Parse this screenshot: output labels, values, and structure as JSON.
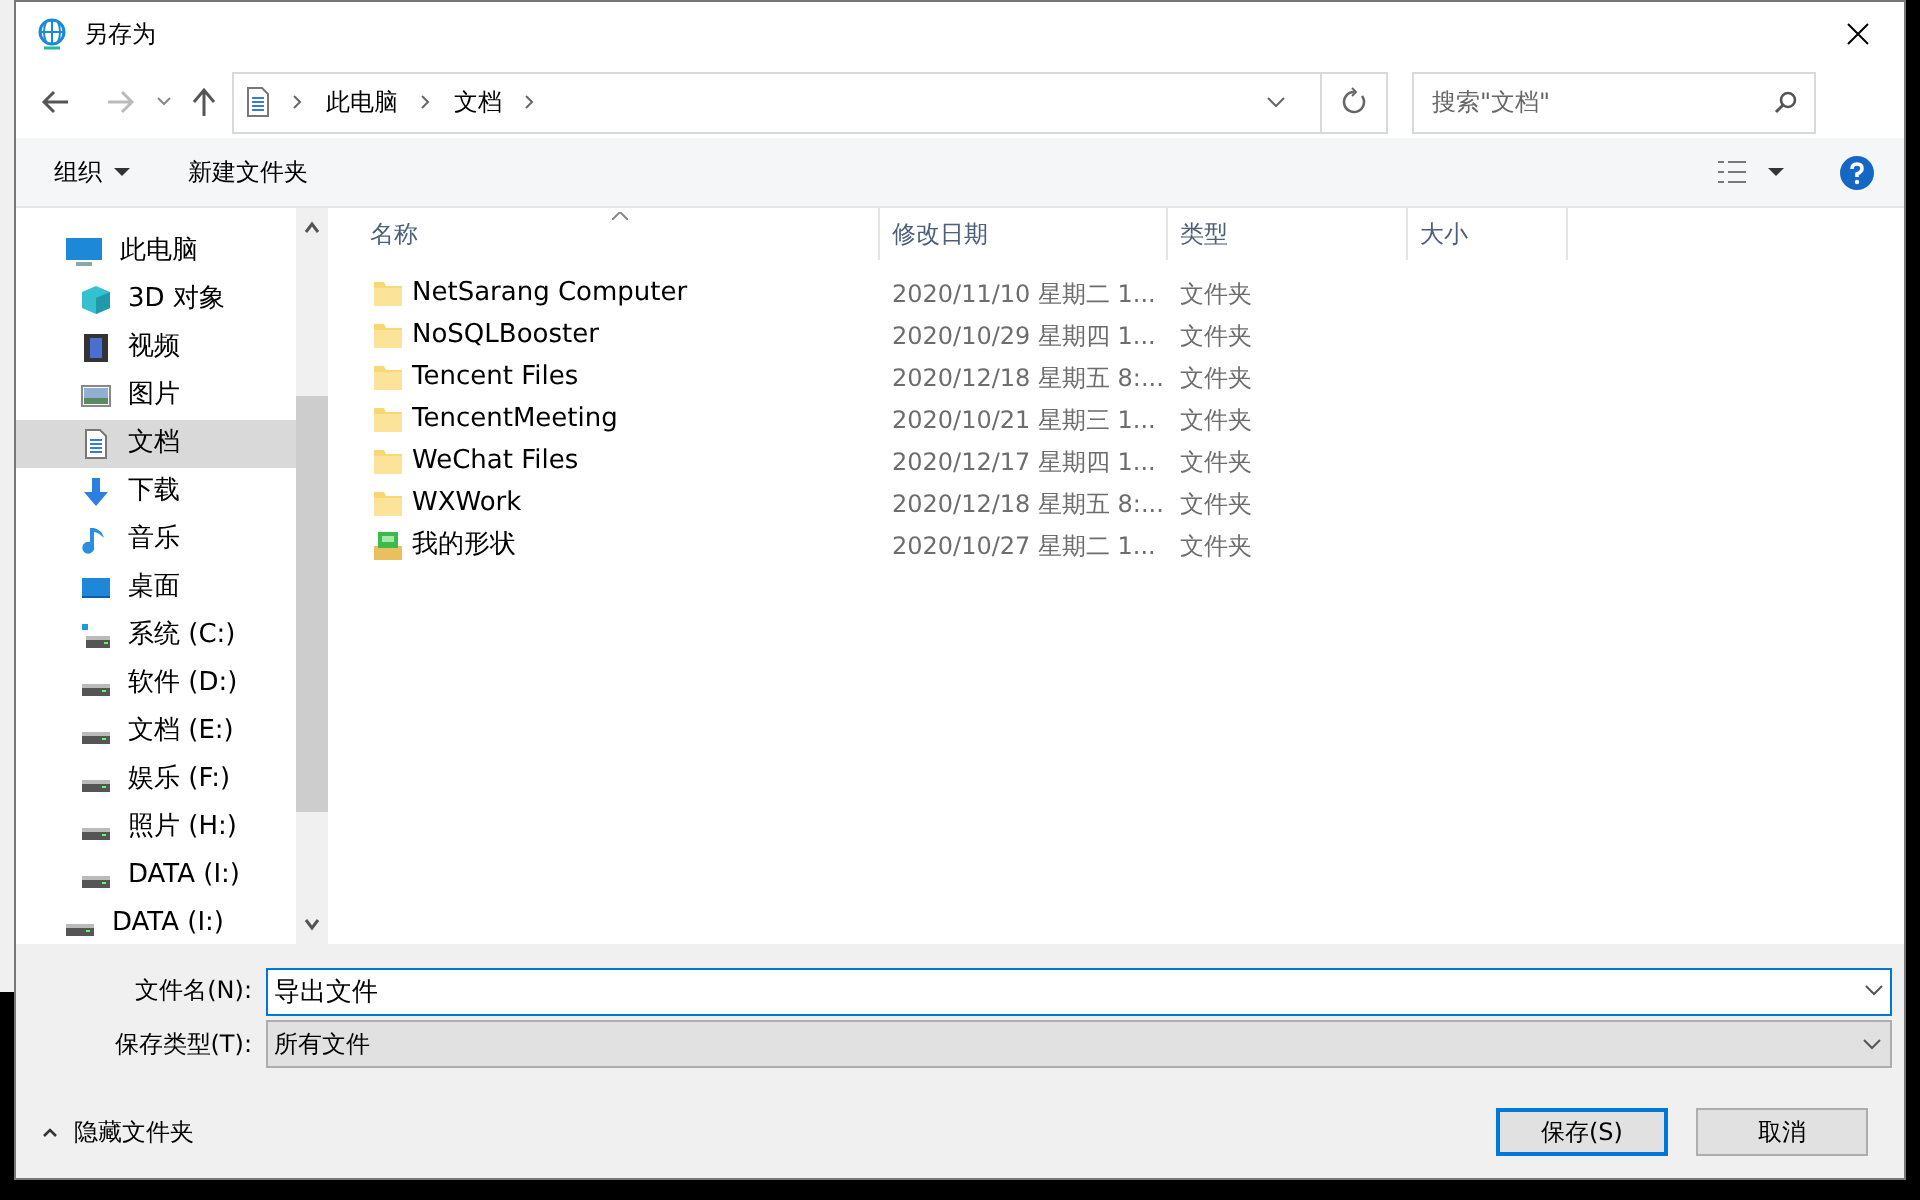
{
  "window": {
    "title": "另存为"
  },
  "address": {
    "path": [
      "此电脑",
      "文档"
    ]
  },
  "search": {
    "placeholder": "搜索\"文档\""
  },
  "toolbar": {
    "organize": "组织",
    "new_folder": "新建文件夹"
  },
  "sidebar": {
    "items": [
      {
        "label": "此电脑",
        "kind": "pc",
        "selected": false,
        "children": [
          {
            "label": "3D 对象",
            "kind": "cube",
            "selected": false
          },
          {
            "label": "视频",
            "kind": "video",
            "selected": false
          },
          {
            "label": "图片",
            "kind": "picture",
            "selected": false
          },
          {
            "label": "文档",
            "kind": "document",
            "selected": true
          },
          {
            "label": "下载",
            "kind": "download",
            "selected": false
          },
          {
            "label": "音乐",
            "kind": "music",
            "selected": false
          },
          {
            "label": "桌面",
            "kind": "desktop",
            "selected": false
          },
          {
            "label": "系统 (C:)",
            "kind": "system-drive",
            "selected": false
          },
          {
            "label": "软件 (D:)",
            "kind": "drive",
            "selected": false
          },
          {
            "label": "文档 (E:)",
            "kind": "drive",
            "selected": false
          },
          {
            "label": "娱乐 (F:)",
            "kind": "drive",
            "selected": false
          },
          {
            "label": "照片 (H:)",
            "kind": "drive",
            "selected": false
          },
          {
            "label": "DATA (I:)",
            "kind": "drive",
            "selected": false
          }
        ]
      },
      {
        "label": "DATA (I:)",
        "kind": "drive",
        "selected": false
      }
    ]
  },
  "table": {
    "columns": [
      "名称",
      "修改日期",
      "类型",
      "大小"
    ],
    "rows": [
      {
        "name": "NetSarang Computer",
        "date": "2020/11/10 星期二 1...",
        "type": "文件夹",
        "kind": "folder"
      },
      {
        "name": "NoSQLBooster",
        "date": "2020/10/29 星期四 1...",
        "type": "文件夹",
        "kind": "folder"
      },
      {
        "name": "Tencent Files",
        "date": "2020/12/18 星期五 8:...",
        "type": "文件夹",
        "kind": "folder"
      },
      {
        "name": "TencentMeeting",
        "date": "2020/10/21 星期三 1...",
        "type": "文件夹",
        "kind": "folder"
      },
      {
        "name": "WeChat Files",
        "date": "2020/12/17 星期四 1...",
        "type": "文件夹",
        "kind": "folder"
      },
      {
        "name": "WXWork",
        "date": "2020/12/18 星期五 8:...",
        "type": "文件夹",
        "kind": "folder"
      },
      {
        "name": "我的形状",
        "date": "2020/10/27 星期二 1...",
        "type": "文件夹",
        "kind": "shapes"
      }
    ]
  },
  "form": {
    "filename_label": "文件名(N):",
    "filename": "导出文件",
    "type_label": "保存类型(T):",
    "type_value": "所有文件"
  },
  "hide_folders": "隐藏文件夹",
  "buttons": {
    "save": "保存(S)",
    "cancel": "取消"
  }
}
